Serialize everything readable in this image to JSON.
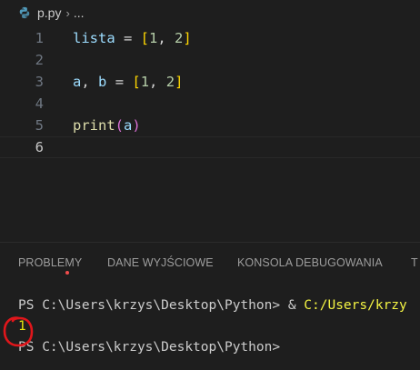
{
  "breadcrumb": {
    "file": "p.py",
    "separator": "›",
    "more": "...",
    "icon": "python-file-icon"
  },
  "editor": {
    "lines": [
      {
        "number": "1",
        "code": "lista = [1, 2]"
      },
      {
        "number": "2",
        "code": ""
      },
      {
        "number": "3",
        "code": "a, b = [1, 2]"
      },
      {
        "number": "4",
        "code": ""
      },
      {
        "number": "5",
        "code": "print(a)"
      },
      {
        "number": "6",
        "code": ""
      }
    ],
    "current_line": "6"
  },
  "panel": {
    "tabs": [
      {
        "label": "PROBLEMY",
        "has_badge": true
      },
      {
        "label": "DANE WYJŚCIOWE"
      },
      {
        "label": "KONSOLA DEBUGOWANIA"
      },
      {
        "label": "T"
      }
    ],
    "badge_color": "#f14c4c"
  },
  "terminal": {
    "line1_prompt": "PS C:\\Users\\krzys\\Desktop\\Python> ",
    "line1_amp": "& ",
    "line1_path": "C:/Users/krzy",
    "output": "1",
    "line3_prompt": "PS C:\\Users\\krzys\\Desktop\\Python>"
  },
  "colors": {
    "background": "#1e1e1e",
    "annotation": "#e0161b",
    "output_yellow": "#e5e510"
  }
}
